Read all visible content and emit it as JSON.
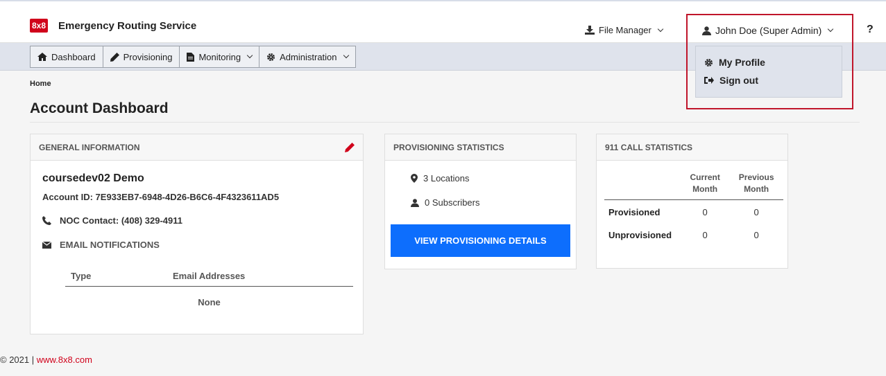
{
  "brand": {
    "logo_text": "8x8",
    "app_title": "Emergency Routing Service",
    "accent": "#d0021b"
  },
  "header": {
    "file_manager_label": "File Manager",
    "user_label": "John Doe (Super Admin)",
    "help_label": "?"
  },
  "user_dropdown": {
    "items": [
      {
        "label": "My Profile",
        "icon": "gear-icon"
      },
      {
        "label": "Sign out",
        "icon": "sign-out-icon"
      }
    ]
  },
  "nav": {
    "tabs": [
      {
        "label": "Dashboard",
        "icon": "home-icon"
      },
      {
        "label": "Provisioning",
        "icon": "pencil-icon"
      },
      {
        "label": "Monitoring",
        "icon": "file-icon"
      },
      {
        "label": "Administration",
        "icon": "gear-icon"
      }
    ]
  },
  "page": {
    "breadcrumb": "Home",
    "title": "Account Dashboard"
  },
  "general": {
    "heading": "GENERAL INFORMATION",
    "account_name": "coursedev02 Demo",
    "account_id": "Account ID:  7E933EB7-6948-4D26-B6C6-4F4323611AD5",
    "noc_contact": "NOC Contact: (408) 329-4911",
    "email_notifications": "EMAIL NOTIFICATIONS",
    "email_table": {
      "col_type": "Type",
      "col_email": "Email Addresses",
      "empty": "None"
    }
  },
  "provisioning": {
    "heading": "PROVISIONING STATISTICS",
    "locations": "3 Locations",
    "subscribers": "0 Subscribers",
    "button": "VIEW PROVISIONING DETAILS",
    "button_color": "#0d6efd"
  },
  "calls": {
    "heading": "911 CALL STATISTICS",
    "col_current": "Current Month",
    "col_previous": "Previous Month",
    "rows": [
      {
        "label": "Provisioned",
        "current": "0",
        "previous": "0"
      },
      {
        "label": "Unprovisioned",
        "current": "0",
        "previous": "0"
      }
    ]
  },
  "footer": {
    "copyright": "© 2021 | ",
    "link": "www.8x8.com"
  }
}
